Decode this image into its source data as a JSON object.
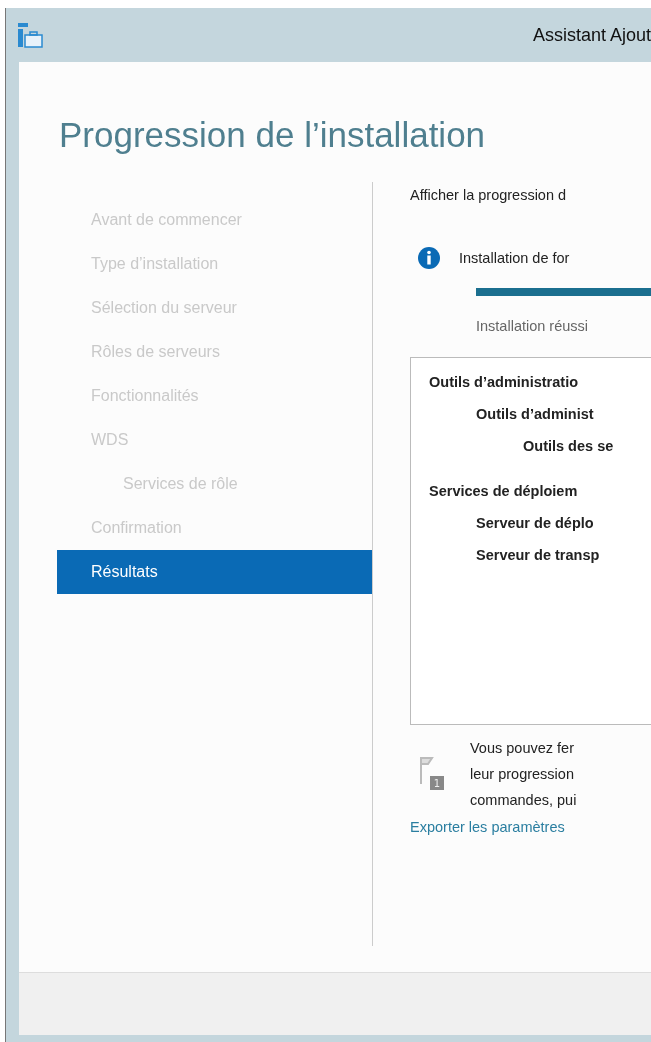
{
  "window": {
    "title": "Assistant Ajout"
  },
  "heading": "Progression de l’installation",
  "steps": [
    {
      "label": "Avant de commencer",
      "selected": false
    },
    {
      "label": "Type d’installation",
      "selected": false
    },
    {
      "label": "Sélection du serveur",
      "selected": false
    },
    {
      "label": "Rôles de serveurs",
      "selected": false
    },
    {
      "label": "Fonctionnalités",
      "selected": false
    },
    {
      "label": "WDS",
      "selected": false,
      "children": [
        {
          "label": "Services de rôle",
          "selected": false
        }
      ]
    },
    {
      "label": "Confirmation",
      "selected": false
    },
    {
      "label": "Résultats",
      "selected": true
    }
  ],
  "progress": {
    "caption": "Afficher la progression d",
    "status": "Installation de for",
    "level": 1,
    "result": "Installation réussi"
  },
  "results": [
    {
      "label": "Outils d’administratio",
      "children": [
        {
          "label": "Outils d’administ",
          "children": [
            {
              "label": "Outils des se"
            }
          ]
        }
      ]
    },
    {
      "label": "Services de déploiem",
      "children": [
        {
          "label": "Serveur de déplo"
        },
        {
          "label": "Serveur de transp"
        }
      ]
    }
  ],
  "note": {
    "badge": "1",
    "lines": [
      "Vous pouvez fer",
      "leur progression",
      "commandes, pui"
    ]
  },
  "export_link": "Exporter les paramètres"
}
